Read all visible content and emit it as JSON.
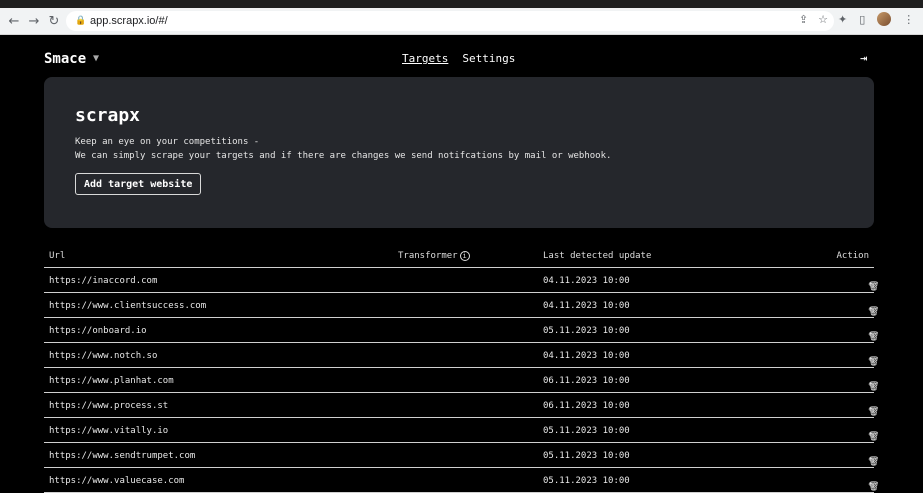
{
  "browser": {
    "url": "app.scrapx.io/#/",
    "nav": {
      "back": "←",
      "forward": "→",
      "reload": "↻"
    },
    "icons": [
      "share-icon",
      "bookmark-star-icon",
      "extensions-icon",
      "sidebar-icon",
      "profile-avatar"
    ]
  },
  "app": {
    "brand": "Smace",
    "tabs": [
      {
        "label": "Targets",
        "active": true
      },
      {
        "label": "Settings",
        "active": false
      }
    ],
    "logout_icon": "logout-icon"
  },
  "hero": {
    "title": "scrapx",
    "line1": "Keep an eye on your competitions -",
    "line2": "We can simply scrape your targets and if there are changes we send notifcations by mail or webhook.",
    "button": "Add target website"
  },
  "table": {
    "headers": {
      "url": "Url",
      "transformer": "Transformer",
      "last_update": "Last detected update",
      "action": "Action"
    },
    "rows": [
      {
        "url": "https://inaccord.com",
        "date": "04.11.2023 10:00"
      },
      {
        "url": "https://www.clientsuccess.com",
        "date": "04.11.2023 10:00"
      },
      {
        "url": "https://onboard.io",
        "date": "05.11.2023 10:00"
      },
      {
        "url": "https://www.notch.so",
        "date": "04.11.2023 10:00"
      },
      {
        "url": "https://www.planhat.com",
        "date": "06.11.2023 10:00"
      },
      {
        "url": "https://www.process.st",
        "date": "06.11.2023 10:00"
      },
      {
        "url": "https://www.vitally.io",
        "date": "05.11.2023 10:00"
      },
      {
        "url": "https://www.sendtrumpet.com",
        "date": "05.11.2023 10:00"
      },
      {
        "url": "https://www.valuecase.com",
        "date": "05.11.2023 10:00"
      }
    ]
  }
}
